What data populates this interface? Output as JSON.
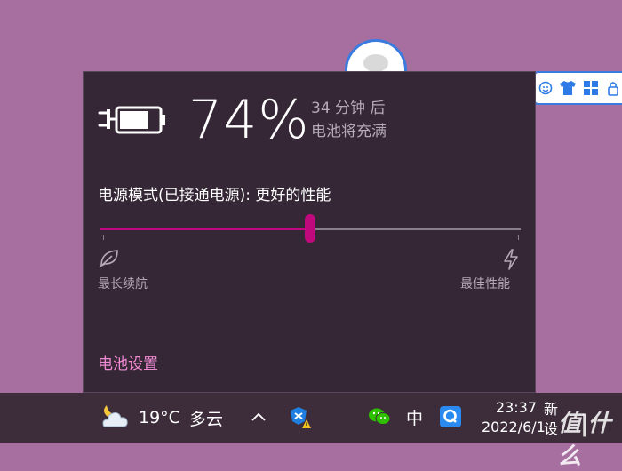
{
  "flyout": {
    "percent": "74%",
    "time_line1": "34 分钟  后",
    "time_line2": "电池将充满",
    "power_mode_label": "电源模式(已接通电源): 更好的性能",
    "slider_value_fraction": 0.5,
    "left_label": "最长续航",
    "right_label": "最佳性能",
    "settings_link": "电池设置",
    "accent_color": "#c0097d"
  },
  "taskbar": {
    "weather_temp": "19°C",
    "weather_desc": "多云",
    "ime_lang": "中",
    "clock_time": "23:37",
    "clock_date": "2022/6/1",
    "overflow_text": "新\n设",
    "watermark": "值|什么"
  },
  "icons": {
    "battery": "battery-charging-icon",
    "leaf": "leaf-icon",
    "bolt": "lightning-icon",
    "weather": "partly-cloudy-night-icon",
    "chevron": "chevron-up-icon",
    "wechat": "wechat-icon",
    "qq": "qq-icon"
  }
}
